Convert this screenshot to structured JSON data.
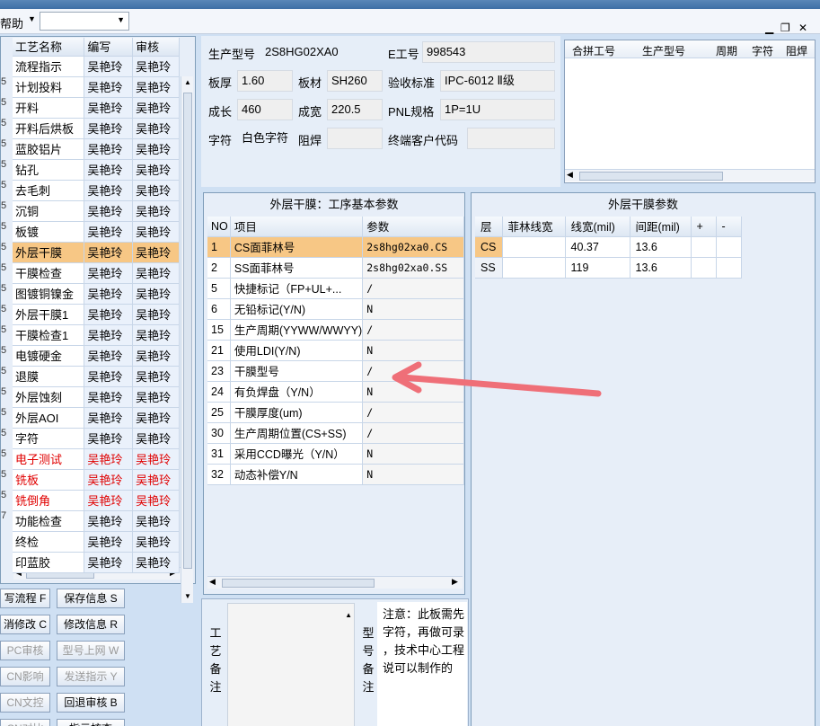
{
  "menubar": {
    "help": "帮助"
  },
  "process_grid": {
    "headers": [
      "工艺名称",
      "编写",
      "审核"
    ],
    "row_marks": [
      "5",
      "5",
      "5",
      "5",
      "5",
      "5",
      "5",
      "5",
      "5",
      "5",
      "5",
      "5",
      "5",
      "5",
      "5",
      "5",
      "5",
      "5",
      "5",
      "5",
      "5",
      "7",
      "",
      "",
      "",
      "",
      ""
    ],
    "rows": [
      {
        "name": "流程指示",
        "author": "吴艳玲",
        "reviewer": "吴艳玲"
      },
      {
        "name": "计划投料",
        "author": "吴艳玲",
        "reviewer": "吴艳玲"
      },
      {
        "name": "开料",
        "author": "吴艳玲",
        "reviewer": "吴艳玲"
      },
      {
        "name": "开料后烘板",
        "author": "吴艳玲",
        "reviewer": "吴艳玲"
      },
      {
        "name": "蓝胶铝片",
        "author": "吴艳玲",
        "reviewer": "吴艳玲"
      },
      {
        "name": "钻孔",
        "author": "吴艳玲",
        "reviewer": "吴艳玲"
      },
      {
        "name": "去毛刺",
        "author": "吴艳玲",
        "reviewer": "吴艳玲"
      },
      {
        "name": "沉铜",
        "author": "吴艳玲",
        "reviewer": "吴艳玲"
      },
      {
        "name": "板镀",
        "author": "吴艳玲",
        "reviewer": "吴艳玲"
      },
      {
        "name": "外层干膜",
        "author": "吴艳玲",
        "reviewer": "吴艳玲"
      },
      {
        "name": "干膜检查",
        "author": "吴艳玲",
        "reviewer": "吴艳玲"
      },
      {
        "name": "图镀铜镍金",
        "author": "吴艳玲",
        "reviewer": "吴艳玲"
      },
      {
        "name": "外层干膜1",
        "author": "吴艳玲",
        "reviewer": "吴艳玲"
      },
      {
        "name": "干膜检查1",
        "author": "吴艳玲",
        "reviewer": "吴艳玲"
      },
      {
        "name": "电镀硬金",
        "author": "吴艳玲",
        "reviewer": "吴艳玲"
      },
      {
        "name": "退膜",
        "author": "吴艳玲",
        "reviewer": "吴艳玲"
      },
      {
        "name": "外层蚀刻",
        "author": "吴艳玲",
        "reviewer": "吴艳玲"
      },
      {
        "name": "外层AOI",
        "author": "吴艳玲",
        "reviewer": "吴艳玲"
      },
      {
        "name": "字符",
        "author": "吴艳玲",
        "reviewer": "吴艳玲"
      },
      {
        "name": "电子测试",
        "author": "吴艳玲",
        "reviewer": "吴艳玲"
      },
      {
        "name": "铣板",
        "author": "吴艳玲",
        "reviewer": "吴艳玲"
      },
      {
        "name": "铣倒角",
        "author": "吴艳玲",
        "reviewer": "吴艳玲"
      },
      {
        "name": "功能检查",
        "author": "吴艳玲",
        "reviewer": "吴艳玲"
      },
      {
        "name": "终检",
        "author": "吴艳玲",
        "reviewer": "吴艳玲"
      },
      {
        "name": "印蓝胶",
        "author": "吴艳玲",
        "reviewer": "吴艳玲"
      }
    ]
  },
  "left_buttons": {
    "write_flow": "写流程 F",
    "save_info": "保存信息 S",
    "cancel_edit": "消修改 C",
    "edit_info": "修改信息 R",
    "pc_review": "PC审核",
    "model_online": "型号上网 W",
    "ecn_impact": "CN影响",
    "send_instruction": "发送指示 Y",
    "ecn_archive": "CN文控",
    "return_review": "回退审核 B",
    "ecn_compare": "CN对比",
    "instruction_review": "指示核查"
  },
  "info": {
    "model_label": "生产型号",
    "model_value": "2S8HG02XA0",
    "eno_label": "E工号",
    "eno_value": "998543",
    "thickness_label": "板厚",
    "thickness_value": "1.60",
    "material_label": "板材",
    "material_value": "SH260",
    "standard_label": "验收标准",
    "standard_value": "IPC-6012 Ⅱ级",
    "length_label": "成长",
    "length_value": "460",
    "width_label": "成宽",
    "width_value": "220.5",
    "pnl_label": "PNL规格",
    "pnl_value": "1P=1U",
    "char_label": "字符",
    "char_value": "白色字符",
    "solder_label": "阻焊",
    "solder_value": "",
    "customer_label": "终端客户代码",
    "customer_value": ""
  },
  "merge_table": {
    "headers": [
      "合拼工号",
      "生产型号",
      "周期",
      "字符",
      "阻焊"
    ]
  },
  "process_params": {
    "title": "外层干膜：工序基本参数",
    "headers": [
      "NO",
      "项目",
      "参数"
    ],
    "rows": [
      {
        "no": "1",
        "item": "CS面菲林号",
        "value": "2s8hg02xa0.CS"
      },
      {
        "no": "2",
        "item": "SS面菲林号",
        "value": "2s8hg02xa0.SS"
      },
      {
        "no": "5",
        "item": "快捷标记（FP+UL+...",
        "value": "/"
      },
      {
        "no": "6",
        "item": "无铅标记(Y/N)",
        "value": "N"
      },
      {
        "no": "15",
        "item": "生产周期(YYWW/WWYY)",
        "value": "/"
      },
      {
        "no": "21",
        "item": "使用LDI(Y/N)",
        "value": "N"
      },
      {
        "no": "23",
        "item": "干膜型号",
        "value": "/"
      },
      {
        "no": "24",
        "item": "有负焊盘（Y/N）",
        "value": "N"
      },
      {
        "no": "25",
        "item": "干膜厚度(um)",
        "value": "/"
      },
      {
        "no": "30",
        "item": "生产周期位置(CS+SS)",
        "value": "/"
      },
      {
        "no": "31",
        "item": "采用CCD曝光（Y/N）",
        "value": "N"
      },
      {
        "no": "32",
        "item": "动态补偿Y/N",
        "value": "N"
      }
    ]
  },
  "film_params": {
    "title": "外层干膜参数",
    "headers": [
      "层",
      "菲林线宽",
      "线宽(mil)",
      "间距(mil)",
      "+",
      "-"
    ],
    "rows": [
      {
        "layer": "CS",
        "film_width": "",
        "line_width": "40.37",
        "spacing": "13.6"
      },
      {
        "layer": "SS",
        "film_width": "",
        "line_width": "119",
        "spacing": "13.6"
      }
    ]
  },
  "remarks": {
    "process_label": [
      "工",
      "艺",
      "备",
      "注"
    ],
    "model_label": [
      "型",
      "号",
      "备",
      "注"
    ],
    "note_lines": [
      "注意：此板需先",
      "字符，再做可录",
      "，技术中心工程",
      "说可以制作的"
    ]
  },
  "colors": {
    "selected_row": "#f7c785",
    "red_text": "#e00000",
    "arrow": "#ef6f78"
  }
}
